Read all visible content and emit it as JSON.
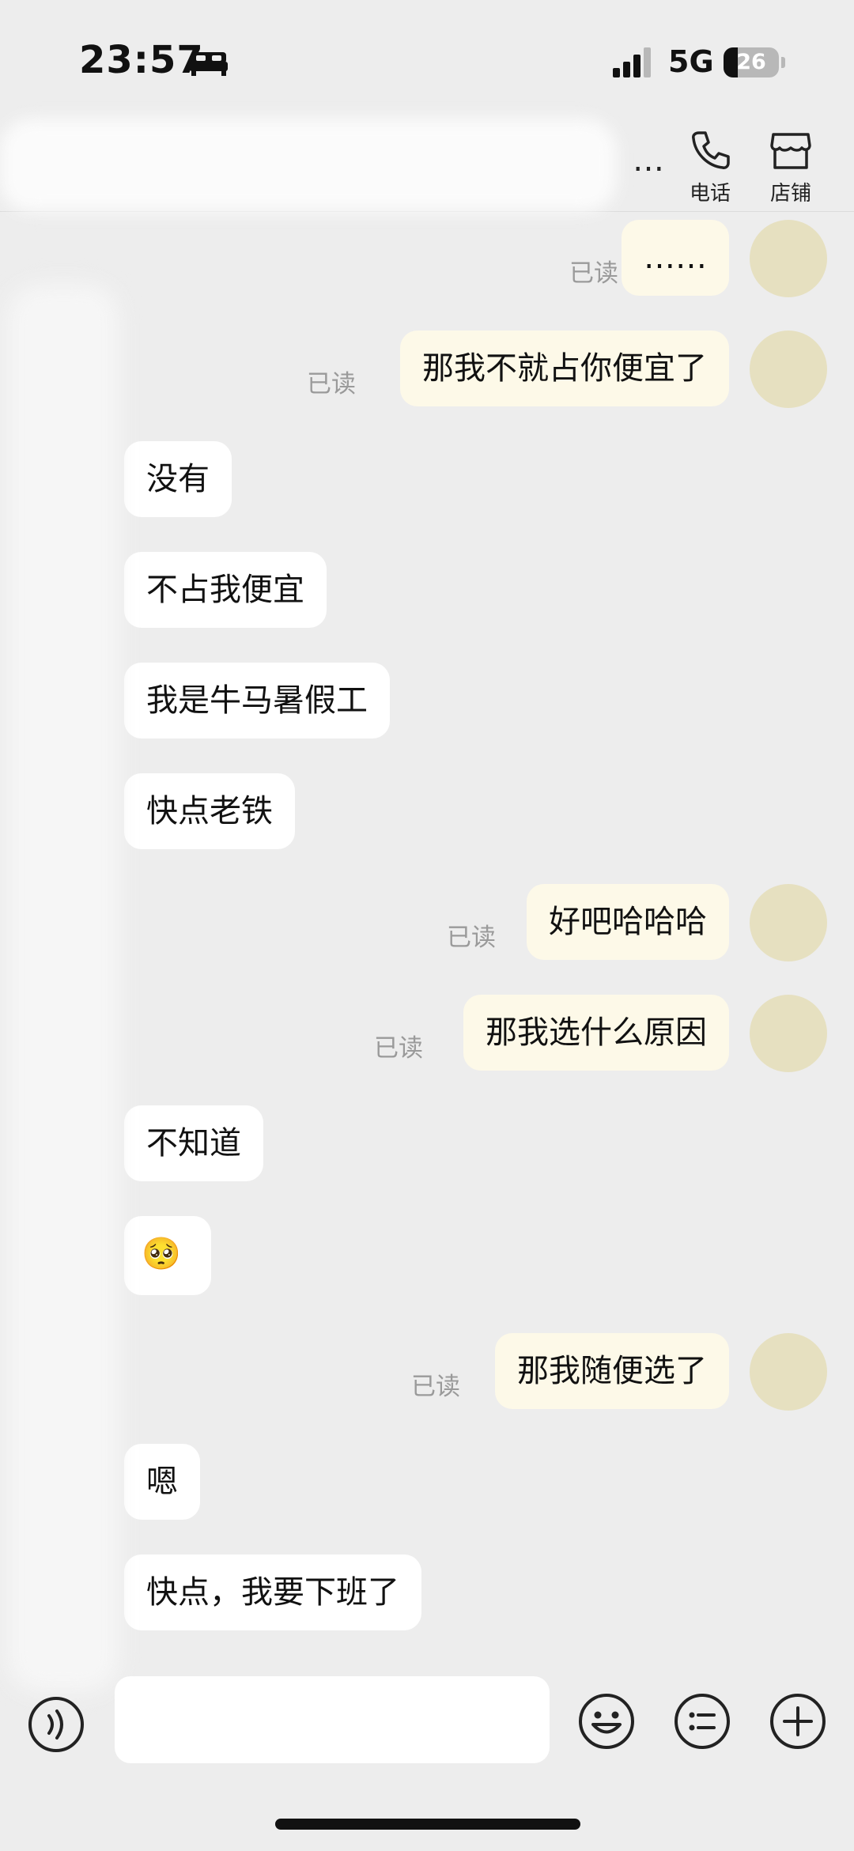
{
  "status_bar": {
    "time": "23:57",
    "network": "5G",
    "battery": "26",
    "battery_level": 0.26,
    "icons": [
      "bed-icon",
      "signal-icon",
      "battery-icon"
    ]
  },
  "nav": {
    "title": "…",
    "actions": [
      {
        "label": "电话",
        "icon": "phone-icon"
      },
      {
        "label": "店铺",
        "icon": "shop-icon"
      }
    ]
  },
  "messages": [
    {
      "direction": "out",
      "text": "……",
      "status": "已读"
    },
    {
      "direction": "out",
      "text": "那我不就占你便宜了",
      "status": "已读"
    },
    {
      "direction": "in",
      "text": "没有"
    },
    {
      "direction": "in",
      "text": "不占我便宜"
    },
    {
      "direction": "in",
      "text": "我是牛马暑假工"
    },
    {
      "direction": "in",
      "text": "快点老铁"
    },
    {
      "direction": "out",
      "text": "好吧哈哈哈",
      "status": "已读"
    },
    {
      "direction": "out",
      "text": "那我选什么原因",
      "status": "已读"
    },
    {
      "direction": "in",
      "text": "不知道"
    },
    {
      "direction": "in",
      "text": "🥺",
      "kind": "emoji"
    },
    {
      "direction": "out",
      "text": "那我随便选了",
      "status": "已读"
    },
    {
      "direction": "in",
      "text": "嗯"
    },
    {
      "direction": "in",
      "text": "快点，我要下班了"
    }
  ],
  "input_bar": {
    "placeholder": "",
    "icons": [
      "voice-icon",
      "emoji-icon",
      "quick-reply-icon",
      "plus-icon"
    ]
  },
  "colors": {
    "background": "#ededed",
    "incoming_bubble": "#ffffff",
    "outgoing_bubble": "#fdf9e8",
    "avatar": "#e6e0c0",
    "read_text": "#9a9a9a"
  }
}
